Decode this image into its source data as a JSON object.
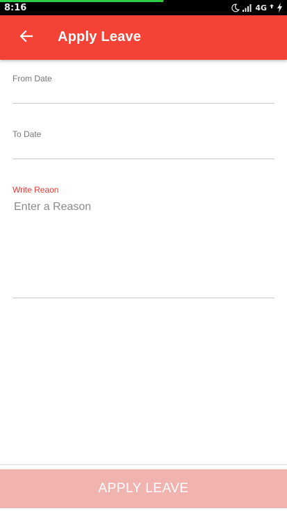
{
  "status_bar": {
    "time": "8:16",
    "network": "4G",
    "load_progress_percent": 57,
    "progress_color": "#2ecc40"
  },
  "app_bar": {
    "title": "Apply Leave",
    "back_icon": "arrow-left-icon",
    "background_color": "#f44336"
  },
  "form": {
    "from_date": {
      "label": "From Date",
      "value": ""
    },
    "to_date": {
      "label": "To Date",
      "value": ""
    },
    "reason": {
      "label": "Write Reaon",
      "placeholder": "Enter a Reason",
      "value": ""
    }
  },
  "apply_button": {
    "label": "APPLY LEAVE",
    "color": "#f0b3b0"
  },
  "colors": {
    "accent": "#e53935",
    "label": "#757575",
    "divider": "#c8c8c8"
  }
}
